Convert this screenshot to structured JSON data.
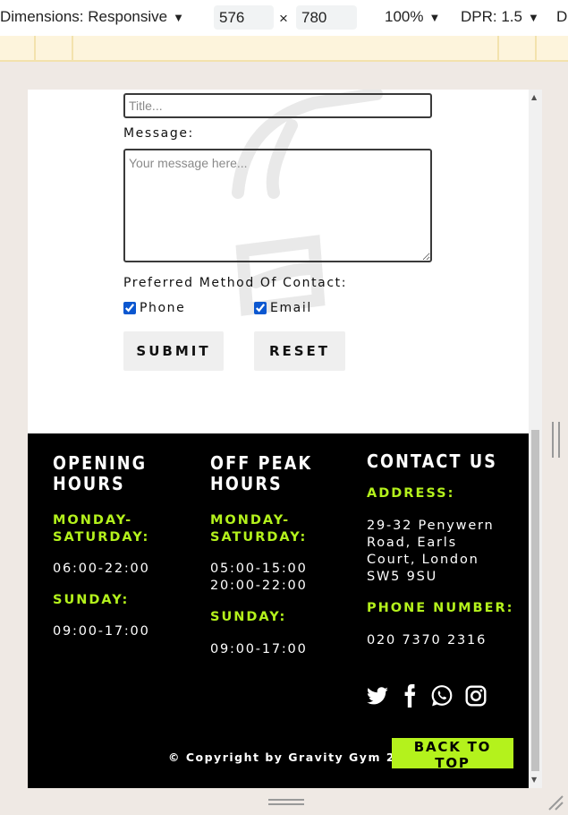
{
  "devtools": {
    "dimensions_label": "Dimensions: Responsive",
    "width": "576",
    "times": "×",
    "height": "780",
    "zoom": "100%",
    "dpr": "DPR: 1.5",
    "overflow_label": "D"
  },
  "form": {
    "title_placeholder": "Title...",
    "message_label": "Message:",
    "message_placeholder": "Your message here...",
    "contact_label": "Preferred Method Of Contact:",
    "phone_label": "Phone",
    "phone_checked": true,
    "email_label": "Email",
    "email_checked": true,
    "submit_label": "Submit",
    "reset_label": "Reset"
  },
  "footer": {
    "opening": {
      "heading_line1": "Opening",
      "heading_line2": "Hours",
      "weekdays_line1": "Monday-",
      "weekdays_line2": "Saturday:",
      "weekdays_hours": "06:00-22:00",
      "sunday_label": "Sunday:",
      "sunday_hours": "09:00-17:00"
    },
    "offpeak": {
      "heading_line1": "Off Peak",
      "heading_line2": "Hours",
      "weekdays_line1": "Monday-",
      "weekdays_line2": "Saturday:",
      "weekdays_hours_1": "05:00-15:00",
      "weekdays_hours_2": "20:00-22:00",
      "sunday_label": "Sunday:",
      "sunday_hours": "09:00-17:00"
    },
    "contact": {
      "heading": "Contact Us",
      "address_label": "Address:",
      "address_line1": "29-32 Penywern",
      "address_line2": "Road, Earls",
      "address_line3": "Court, London",
      "address_line4": "SW5 9SU",
      "phone_label": "Phone Number:",
      "phone": "020 7370 2316"
    },
    "social_icons": [
      "twitter-icon",
      "facebook-icon",
      "whatsapp-icon",
      "instagram-icon"
    ],
    "copyright": "© Copyright by Gravity Gym 2024",
    "back_to_top": "Back To Top"
  },
  "colors": {
    "accent": "#b4f21c",
    "footer_bg": "#000000",
    "button_bg": "#efefef"
  }
}
